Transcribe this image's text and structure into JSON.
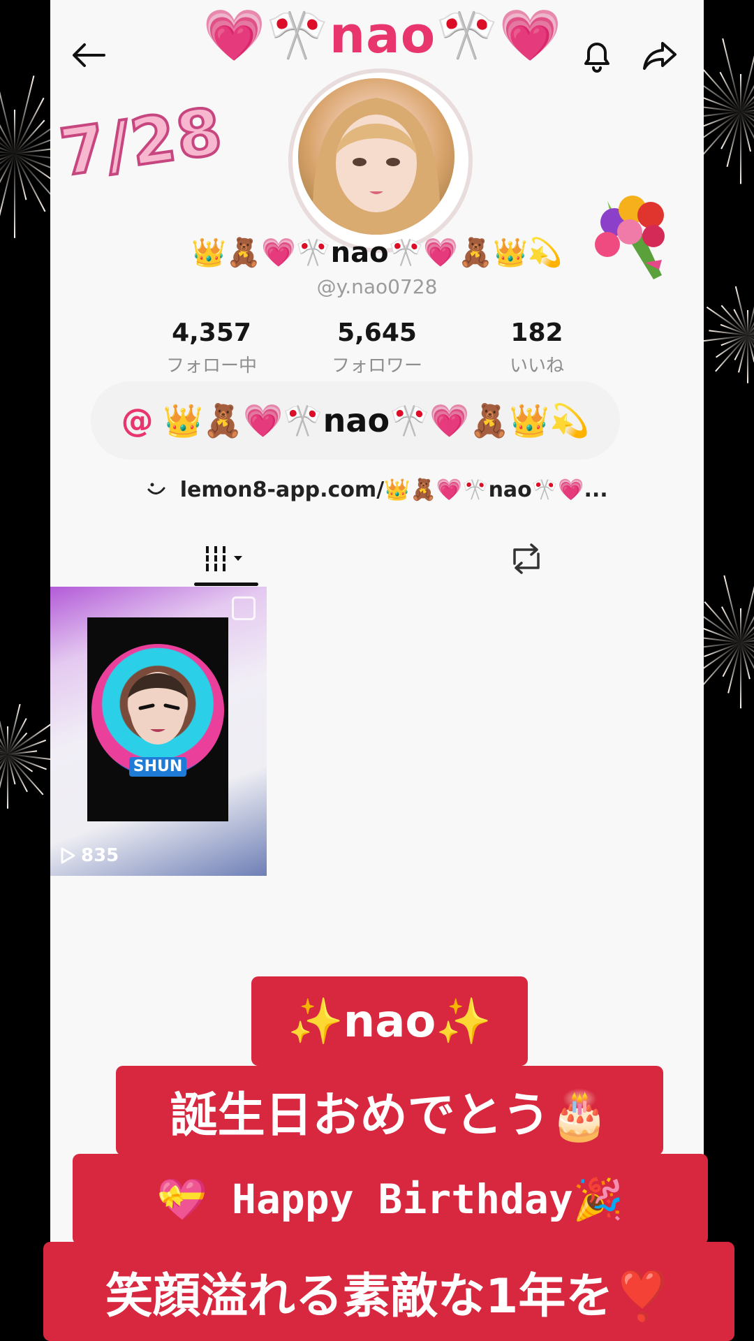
{
  "header": {
    "title": "💗🎌nao🎌💗",
    "back_icon": "arrow-left-icon",
    "bell_icon": "bell-icon",
    "share_icon": "share-icon"
  },
  "overlay": {
    "date": "7/28",
    "bouquet_icon": "bouquet-icon"
  },
  "profile": {
    "display_name": "👑🧸💗🎌nao🎌💗🧸👑💫",
    "handle": "@y.nao0728",
    "stats": [
      {
        "value": "4,357",
        "label": "フォロー中"
      },
      {
        "value": "5,645",
        "label": "フォロワー"
      },
      {
        "value": "182",
        "label": "いいね"
      }
    ],
    "mention": "👑🧸💗🎌nao🎌💗🧸👑💫",
    "mention_prefix": "@",
    "bio_link": "lemon8-app.com/👑🧸💗🎌nao🎌💗..."
  },
  "tabs": {
    "videos_icon": "grid-icon",
    "reposts_icon": "repost-icon"
  },
  "video": {
    "thumb_label": "SHUN",
    "views": "835"
  },
  "banners": [
    "✨nao✨",
    "誕生日おめでとう🎂",
    "💝 Happy Birthday🎉",
    "笑顔溢れる素敵な1年を❣️"
  ],
  "colors": {
    "accent": "#e8356d",
    "banner": "#d8283f",
    "panel": "#f8f8f8"
  }
}
